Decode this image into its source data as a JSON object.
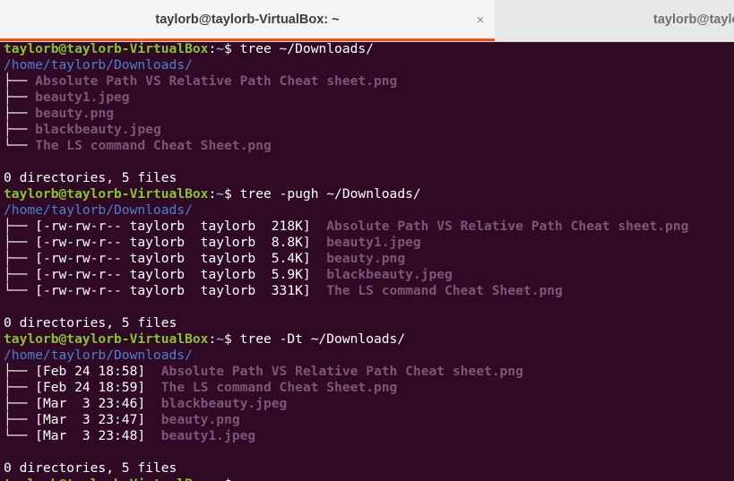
{
  "tabs": [
    {
      "title": "taylorb@taylorb-VirtualBox: ~",
      "active": true,
      "close": "×"
    },
    {
      "title": "taylorb@taylorb-VirtualBox: ~",
      "active": false
    }
  ],
  "prompt": {
    "user_host": "taylorb@taylorb-VirtualBox",
    "sep": ":",
    "path": "~",
    "symbol": "$ "
  },
  "blocks": [
    {
      "command": "tree ~/Downloads/",
      "root": "/home/taylorb/Downloads/",
      "entries": [
        {
          "branch": "├── ",
          "meta": "",
          "name": "Absolute Path VS Relative Path Cheat sheet.png"
        },
        {
          "branch": "├── ",
          "meta": "",
          "name": "beauty1.jpeg"
        },
        {
          "branch": "├── ",
          "meta": "",
          "name": "beauty.png"
        },
        {
          "branch": "├── ",
          "meta": "",
          "name": "blackbeauty.jpeg"
        },
        {
          "branch": "└── ",
          "meta": "",
          "name": "The LS command Cheat Sheet.png"
        }
      ],
      "summary": "0 directories, 5 files"
    },
    {
      "command": "tree -pugh ~/Downloads/",
      "root": "/home/taylorb/Downloads/",
      "entries": [
        {
          "branch": "├── ",
          "meta": "[-rw-rw-r-- taylorb  taylorb  218K]  ",
          "name": "Absolute Path VS Relative Path Cheat sheet.png"
        },
        {
          "branch": "├── ",
          "meta": "[-rw-rw-r-- taylorb  taylorb  8.8K]  ",
          "name": "beauty1.jpeg"
        },
        {
          "branch": "├── ",
          "meta": "[-rw-rw-r-- taylorb  taylorb  5.4K]  ",
          "name": "beauty.png"
        },
        {
          "branch": "├── ",
          "meta": "[-rw-rw-r-- taylorb  taylorb  5.9K]  ",
          "name": "blackbeauty.jpeg"
        },
        {
          "branch": "└── ",
          "meta": "[-rw-rw-r-- taylorb  taylorb  331K]  ",
          "name": "The LS command Cheat Sheet.png"
        }
      ],
      "summary": "0 directories, 5 files"
    },
    {
      "command": "tree -Dt ~/Downloads/",
      "root": "/home/taylorb/Downloads/",
      "entries": [
        {
          "branch": "├── ",
          "meta": "[Feb 24 18:58]  ",
          "name": "Absolute Path VS Relative Path Cheat sheet.png"
        },
        {
          "branch": "├── ",
          "meta": "[Feb 24 18:59]  ",
          "name": "The LS command Cheat Sheet.png"
        },
        {
          "branch": "├── ",
          "meta": "[Mar  3 23:46]  ",
          "name": "blackbeauty.jpeg"
        },
        {
          "branch": "├── ",
          "meta": "[Mar  3 23:47]  ",
          "name": "beauty.png"
        },
        {
          "branch": "└── ",
          "meta": "[Mar  3 23:48]  ",
          "name": "beauty1.jpeg"
        }
      ],
      "summary": "0 directories, 5 files"
    }
  ],
  "colors": {
    "background": "#300a24",
    "user_host": "#87c236",
    "prompt_path": "#7ea0e0",
    "directory": "#4d7fd2",
    "image_file": "#7a577a",
    "tab_accent": "#e95420"
  }
}
